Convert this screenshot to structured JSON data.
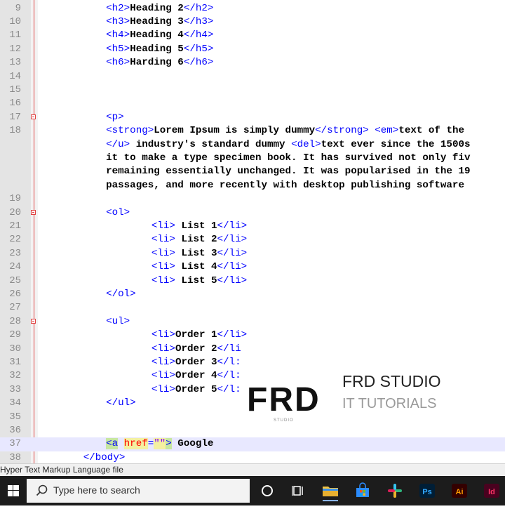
{
  "editor": {
    "lines": [
      {
        "num": "9",
        "indent": 6,
        "segments": [
          [
            "tag",
            "<h2>"
          ],
          [
            "txt",
            "Heading 2"
          ],
          [
            "tag",
            "</h2>"
          ]
        ]
      },
      {
        "num": "10",
        "indent": 6,
        "segments": [
          [
            "tag",
            "<h3>"
          ],
          [
            "txt",
            "Heading 3"
          ],
          [
            "tag",
            "</h3>"
          ]
        ]
      },
      {
        "num": "11",
        "indent": 6,
        "segments": [
          [
            "tag",
            "<h4>"
          ],
          [
            "txt",
            "Heading 4"
          ],
          [
            "tag",
            "</h4>"
          ]
        ]
      },
      {
        "num": "12",
        "indent": 6,
        "segments": [
          [
            "tag",
            "<h5>"
          ],
          [
            "txt",
            "Heading 5"
          ],
          [
            "tag",
            "</h5>"
          ]
        ]
      },
      {
        "num": "13",
        "indent": 6,
        "segments": [
          [
            "tag",
            "<h6>"
          ],
          [
            "txt",
            "Harding 6"
          ],
          [
            "tag",
            "</h6>"
          ]
        ]
      },
      {
        "num": "14",
        "indent": 0,
        "segments": []
      },
      {
        "num": "15",
        "indent": 0,
        "segments": []
      },
      {
        "num": "16",
        "indent": 0,
        "segments": []
      },
      {
        "num": "17",
        "indent": 6,
        "fold": true,
        "segments": [
          [
            "tag",
            "<p>"
          ]
        ]
      },
      {
        "num": "18",
        "indent": 6,
        "segments": [
          [
            "tag",
            "<strong>"
          ],
          [
            "txt",
            "Lorem Ipsum is simply dummy"
          ],
          [
            "tag",
            "</strong>"
          ],
          [
            "txt",
            " "
          ],
          [
            "tag",
            "<em>"
          ],
          [
            "txt",
            "text of the"
          ]
        ]
      },
      {
        "num": "",
        "indent": 6,
        "segments": [
          [
            "tag",
            "</u>"
          ],
          [
            "txt",
            " industry's standard dummy "
          ],
          [
            "tag",
            "<del>"
          ],
          [
            "txt",
            "text ever since the 1500s"
          ]
        ]
      },
      {
        "num": "",
        "indent": 6,
        "segments": [
          [
            "txt",
            "it to make a type specimen book. It has survived not only fiv"
          ]
        ]
      },
      {
        "num": "",
        "indent": 6,
        "segments": [
          [
            "txt",
            "remaining essentially unchanged. It was popularised in the 19"
          ]
        ]
      },
      {
        "num": "",
        "indent": 6,
        "segments": [
          [
            "txt",
            "passages, and more recently with desktop publishing software"
          ]
        ]
      },
      {
        "num": "19",
        "indent": 0,
        "segments": []
      },
      {
        "num": "20",
        "indent": 6,
        "fold": true,
        "segments": [
          [
            "tag",
            "<ol>"
          ]
        ]
      },
      {
        "num": "21",
        "indent": 10,
        "segments": [
          [
            "tag",
            "<li>"
          ],
          [
            "txt",
            " List 1"
          ],
          [
            "tag",
            "</li>"
          ]
        ]
      },
      {
        "num": "22",
        "indent": 10,
        "segments": [
          [
            "tag",
            "<li>"
          ],
          [
            "txt",
            " List 2"
          ],
          [
            "tag",
            "</li>"
          ]
        ]
      },
      {
        "num": "23",
        "indent": 10,
        "segments": [
          [
            "tag",
            "<li>"
          ],
          [
            "txt",
            " List 3"
          ],
          [
            "tag",
            "</li>"
          ]
        ]
      },
      {
        "num": "24",
        "indent": 10,
        "segments": [
          [
            "tag",
            "<li>"
          ],
          [
            "txt",
            " List 4"
          ],
          [
            "tag",
            "</li>"
          ]
        ]
      },
      {
        "num": "25",
        "indent": 10,
        "segments": [
          [
            "tag",
            "<li>"
          ],
          [
            "txt",
            " List 5"
          ],
          [
            "tag",
            "</li>"
          ]
        ]
      },
      {
        "num": "26",
        "indent": 6,
        "segments": [
          [
            "tag",
            "</ol>"
          ]
        ]
      },
      {
        "num": "27",
        "indent": 0,
        "segments": []
      },
      {
        "num": "28",
        "indent": 6,
        "fold": true,
        "segments": [
          [
            "tag",
            "<ul>"
          ]
        ]
      },
      {
        "num": "29",
        "indent": 10,
        "segments": [
          [
            "tag",
            "<li>"
          ],
          [
            "txt",
            "Order 1"
          ],
          [
            "tag",
            "</li>"
          ]
        ]
      },
      {
        "num": "30",
        "indent": 10,
        "segments": [
          [
            "tag",
            "<li>"
          ],
          [
            "txt",
            "Order 2"
          ],
          [
            "tag",
            "</li"
          ]
        ]
      },
      {
        "num": "31",
        "indent": 10,
        "segments": [
          [
            "tag",
            "<li>"
          ],
          [
            "txt",
            "Order 3"
          ],
          [
            "tag",
            "</l:"
          ]
        ]
      },
      {
        "num": "32",
        "indent": 10,
        "segments": [
          [
            "tag",
            "<li>"
          ],
          [
            "txt",
            "Order 4"
          ],
          [
            "tag",
            "</l:"
          ]
        ]
      },
      {
        "num": "33",
        "indent": 10,
        "segments": [
          [
            "tag",
            "<li>"
          ],
          [
            "txt",
            "Order 5"
          ],
          [
            "tag",
            "</l:"
          ]
        ]
      },
      {
        "num": "34",
        "indent": 6,
        "segments": [
          [
            "tag",
            "</ul>"
          ]
        ]
      },
      {
        "num": "35",
        "indent": 0,
        "segments": []
      },
      {
        "num": "36",
        "indent": 0,
        "segments": []
      },
      {
        "num": "37",
        "indent": 6,
        "highlight": true,
        "segments": [
          [
            "tag-match",
            "<a"
          ],
          [
            "txt",
            " "
          ],
          [
            "attr",
            "href"
          ],
          [
            "tag",
            "="
          ],
          [
            "val",
            "\"\""
          ],
          [
            "tag-match",
            ">"
          ],
          [
            "txt",
            " Google"
          ]
        ]
      },
      {
        "num": "38",
        "indent": 4,
        "segments": [
          [
            "tag",
            "</body>"
          ]
        ]
      }
    ]
  },
  "logo": {
    "mark": "FRD",
    "mark_sub": "STUDIO",
    "title": "FRD STUDIO",
    "subtitle": "IT TUTORIALS"
  },
  "statusbar": {
    "file_type": "Hyper Text Markup Language file"
  },
  "taskbar": {
    "search_placeholder": "Type here to search",
    "apps": [
      {
        "name": "cortana-icon",
        "color": "#ffffff"
      },
      {
        "name": "task-view-icon",
        "color": "#ffffff"
      },
      {
        "name": "file-explorer-icon",
        "color": "#f4c542"
      },
      {
        "name": "microsoft-store-icon",
        "color": "#2b8cff"
      },
      {
        "name": "slack-icon",
        "color": "#e01e5a"
      },
      {
        "name": "photoshop-icon",
        "color": "#31a8ff"
      },
      {
        "name": "illustrator-icon",
        "color": "#ff9a00"
      },
      {
        "name": "indesign-icon",
        "color": "#ff3366"
      }
    ],
    "colors": {
      "bar": "#1c1c1c",
      "search": "#f3f3f3",
      "accent": "#8ab4ff"
    }
  }
}
